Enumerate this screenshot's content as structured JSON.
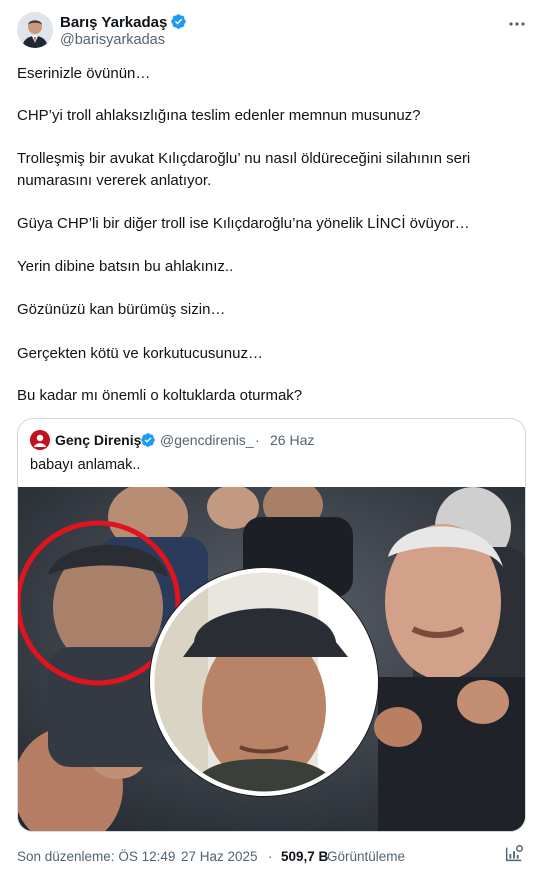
{
  "author": {
    "name": "Barış Yarkadaş",
    "handle": "@barisyarkadas"
  },
  "tweet": {
    "paragraphs": [
      "Eserinizle övünün…",
      "CHP’yi troll ahlaksızlığına teslim edenler memnun musunuz?",
      "Trolleşmiş bir avukat Kılıçdaroğlu’ nu nasıl öldüreceğini silahının seri",
      "numarasını vererek anlatıyor.",
      "Güya CHP’li bir diğer troll ise Kılıçdaroğlu’na yönelik LİNCİ övüyor…",
      "Yerin dibine batsın bu ahlakınız..",
      "Gözünüzü kan bürümüş sizin…",
      "Gerçekten kötü ve korkutucusunuz…",
      "Bu kadar mı önemli o koltuklarda oturmak?"
    ]
  },
  "quote": {
    "name": "Genç Direniş",
    "handle": "@gencdirenis_",
    "separator": "·",
    "date": "26 Haz",
    "text": "babayı anlamak.."
  },
  "footer": {
    "edited_label": "Son düzenleme: ÖS 12:49",
    "separator": "·",
    "date": "27 Haz 2025",
    "views_count": "509,7 B",
    "views_label": "Görüntüleme"
  },
  "colors": {
    "verified": "#1d9bf0",
    "secondary_text": "#536471",
    "primary_text": "#0f1419",
    "border": "#cfd9de",
    "highlight_circle": "#e0141e"
  },
  "icons": {
    "more": "more-dots-icon",
    "verified": "verified-badge-icon",
    "analytics": "analytics-icon"
  }
}
